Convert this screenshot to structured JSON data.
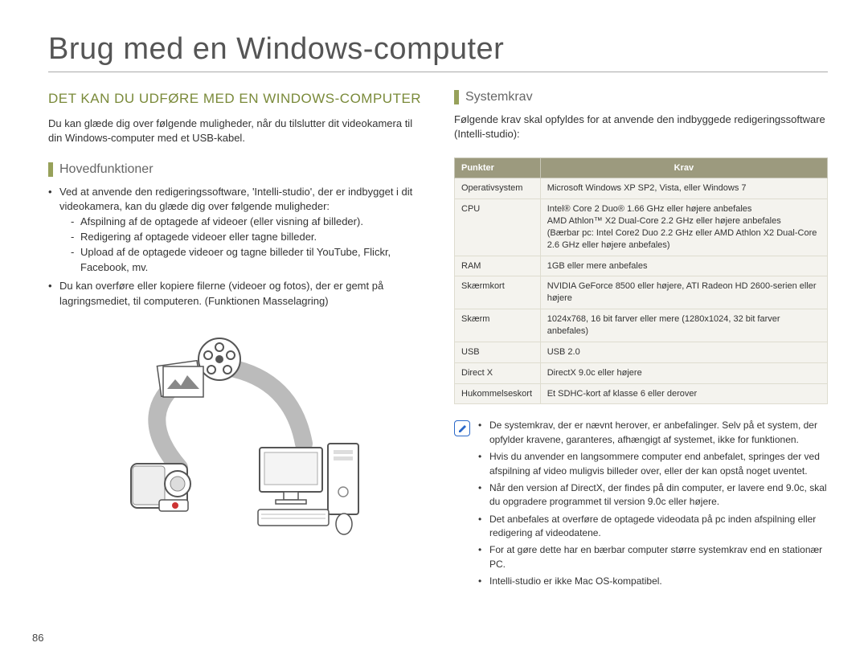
{
  "page_number": "86",
  "title": "Brug med en Windows-computer",
  "left": {
    "heading": "DET KAN DU UDFØRE MED EN WINDOWS-COMPUTER",
    "intro": "Du kan glæde dig over følgende muligheder, når du tilslutter dit videokamera til din Windows-computer med et USB-kabel.",
    "subheading": "Hovedfunktioner",
    "bullet1_lead": "Ved at anvende den redigeringssoftware, 'Intelli-studio', der er indbygget i dit videokamera, kan du glæde dig over følgende muligheder:",
    "bullet1_sub1": "Afspilning af de optagede af videoer (eller visning af billeder).",
    "bullet1_sub2": "Redigering af optagede videoer eller tagne billeder.",
    "bullet1_sub3": "Upload af de optagede videoer og tagne billeder til YouTube, Flickr, Facebook, mv.",
    "bullet2": "Du kan overføre eller kopiere filerne (videoer og fotos), der er gemt på lagringsmediet, til computeren. (Funktionen Masselagring)"
  },
  "right": {
    "subheading": "Systemkrav",
    "intro": "Følgende krav skal opfyldes for at anvende den indbyggede redigeringssoftware (Intelli-studio):",
    "table": {
      "head_col1": "Punkter",
      "head_col2": "Krav",
      "rows": [
        {
          "k": "Operativsystem",
          "v": "Microsoft Windows XP SP2, Vista, eller Windows 7"
        },
        {
          "k": "CPU",
          "v": "Intel® Core 2 Duo® 1.66 GHz eller højere anbefales\nAMD Athlon™ X2 Dual-Core 2.2 GHz eller højere anbefales\n(Bærbar pc: Intel Core2 Duo 2.2 GHz eller AMD Athlon X2 Dual-Core 2.6 GHz eller højere anbefales)"
        },
        {
          "k": "RAM",
          "v": "1GB eller mere anbefales"
        },
        {
          "k": "Skærmkort",
          "v": "NVIDIA GeForce 8500 eller højere, ATI Radeon HD 2600-serien eller højere"
        },
        {
          "k": "Skærm",
          "v": "1024x768, 16 bit farver eller mere (1280x1024, 32 bit farver anbefales)"
        },
        {
          "k": "USB",
          "v": "USB 2.0"
        },
        {
          "k": "Direct X",
          "v": "DirectX 9.0c eller højere"
        },
        {
          "k": "Hukommelseskort",
          "v": "Et SDHC-kort af klasse 6 eller derover"
        }
      ]
    },
    "notes": [
      "De systemkrav, der er nævnt herover, er anbefalinger. Selv på et system, der opfylder kravene, garanteres, afhængigt af systemet, ikke for funktionen.",
      "Hvis du anvender en langsommere computer end anbefalet, springes der ved afspilning af video muligvis billeder over, eller der kan opstå noget uventet.",
      "Når den version af DirectX, der findes på din computer, er lavere end 9.0c, skal du opgradere programmet til version 9.0c eller højere.",
      "Det anbefales at overføre de optagede videodata på pc inden afspilning eller redigering af videodatene.",
      "For at gøre dette har en bærbar computer større systemkrav end en stationær PC.",
      "Intelli-studio er ikke Mac OS-kompatibel."
    ]
  }
}
